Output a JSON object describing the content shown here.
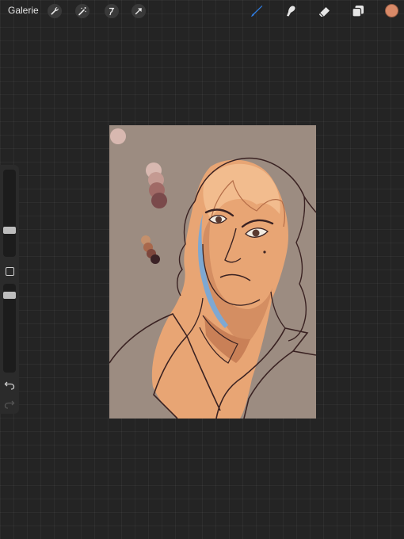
{
  "topbar": {
    "gallery_label": "Galerie",
    "tools_left": [
      "wrench-icon",
      "magic-wand-icon",
      "selection-icon",
      "transform-arrow-icon"
    ],
    "tools_right": [
      "brush-icon",
      "smudge-icon",
      "eraser-icon",
      "layers-icon"
    ],
    "active_tool": "brush-icon",
    "active_color": "#d98a68"
  },
  "sidebar": {
    "brush_size": 0.33,
    "opacity": 0.58,
    "buttons": [
      "modifier-square-icon",
      "undo-icon",
      "redo-icon"
    ]
  },
  "canvas": {
    "background": "#9c8c81",
    "palette": [
      "#d8b8b0",
      "#c49a92",
      "#a06a66",
      "#7a4a4b",
      "#6a3c3e",
      "#c4906c",
      "#a8684c",
      "#7d463c",
      "#3b2226"
    ]
  }
}
